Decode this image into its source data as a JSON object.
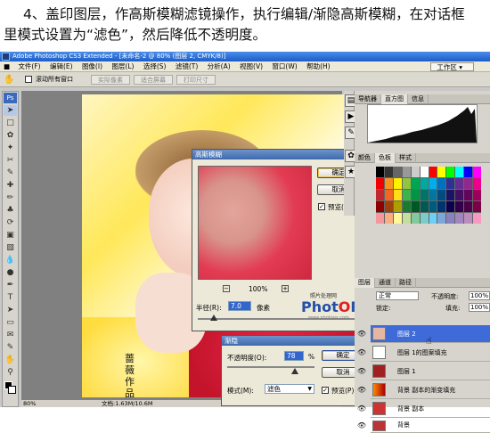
{
  "caption": {
    "line1": "4、盖印图层，作高斯模糊滤镜操作，执行编辑/渐隐高斯模糊，在对话框",
    "line2": "里模式设置为“滤色”，然后降低不透明度。"
  },
  "window": {
    "title": "Adobe Photoshop CS3 Extended - [未命名-2 @ 80% (图层 2, CMYK/8)]"
  },
  "menu": [
    "文件(F)",
    "编辑(E)",
    "图像(I)",
    "图层(L)",
    "选择(S)",
    "滤镜(T)",
    "分析(A)",
    "视图(V)",
    "窗口(W)",
    "帮助(H)"
  ],
  "workspace_label": "工作区 ▾",
  "options": {
    "scroll_all": "滚动所有窗口",
    "actual_pixels": "实际像素",
    "fit_screen": "适合屏幕",
    "print_size": "打印尺寸"
  },
  "canvas": {
    "signature": "蔷\n薇\n作\n品"
  },
  "status": {
    "zoom": "80%",
    "doc": "文档:1.63M/10.6M"
  },
  "gauss_dialog": {
    "title": "高斯模糊",
    "ok": "确定",
    "cancel": "取消",
    "preview": "预览(P)",
    "zoom": "100%",
    "radius_label": "半径(R):",
    "radius_value": "7.0",
    "radius_unit": "像素",
    "slider_fraction": 0.1
  },
  "fade_dialog": {
    "title": "渐隐",
    "opacity_label": "不透明度(O):",
    "opacity_value": "78",
    "opacity_unit": "%",
    "mode_label": "模式(M):",
    "mode_value": "滤色",
    "ok": "确定",
    "cancel": "取消",
    "preview": "预览(P)",
    "slider_fraction": 0.78
  },
  "watermark": {
    "small": "照片处理网",
    "big_a": "Phot",
    "big_b": "PS",
    "url": "www.photops.com"
  },
  "panels": {
    "nav_tabs": [
      "导航器",
      "直方图",
      "信息"
    ],
    "color_tabs": [
      "颜色",
      "色板",
      "样式"
    ],
    "layer_tabs": [
      "图层",
      "通道",
      "路径"
    ],
    "blend_mode": "正常",
    "opacity_label": "不透明度:",
    "opacity_value": "100%",
    "lock_label": "锁定:",
    "fill_label": "填充:",
    "fill_value": "100%",
    "layers": [
      {
        "name": "图层 2",
        "active": true
      },
      {
        "name": "图层 1的图案填充",
        "active": false
      },
      {
        "name": "图层 1",
        "active": false
      },
      {
        "name": "背景 副本的渐变填充",
        "active": false
      },
      {
        "name": "背景 副本",
        "active": false
      },
      {
        "name": "背景",
        "active": false
      }
    ]
  },
  "colors": {
    "swatches": [
      "#000000",
      "#333333",
      "#666666",
      "#999999",
      "#cccccc",
      "#ffffff",
      "#ff0000",
      "#ffff00",
      "#00ff00",
      "#00ffff",
      "#0000ff",
      "#ff00ff",
      "#f00000",
      "#f7941d",
      "#fff200",
      "#8dc63f",
      "#00a651",
      "#00a99d",
      "#00aeef",
      "#0072bc",
      "#2e3192",
      "#662d91",
      "#92278f",
      "#ec008c",
      "#c1272d",
      "#f26522",
      "#ffde17",
      "#39b54a",
      "#009444",
      "#00746b",
      "#0076a3",
      "#004b80",
      "#1b1464",
      "#440e62",
      "#630460",
      "#9e005d",
      "#8c0000",
      "#a0410d",
      "#aba000",
      "#197b30",
      "#005826",
      "#005952",
      "#005b7f",
      "#003471",
      "#0d004c",
      "#32004b",
      "#4b0049",
      "#7b0046",
      "#f5989d",
      "#f9ad81",
      "#fff79a",
      "#c4df9b",
      "#82ca9c",
      "#7accc8",
      "#6dcff6",
      "#7da7d9",
      "#8781bd",
      "#a186be",
      "#bd8cbf",
      "#f49ac1"
    ]
  }
}
